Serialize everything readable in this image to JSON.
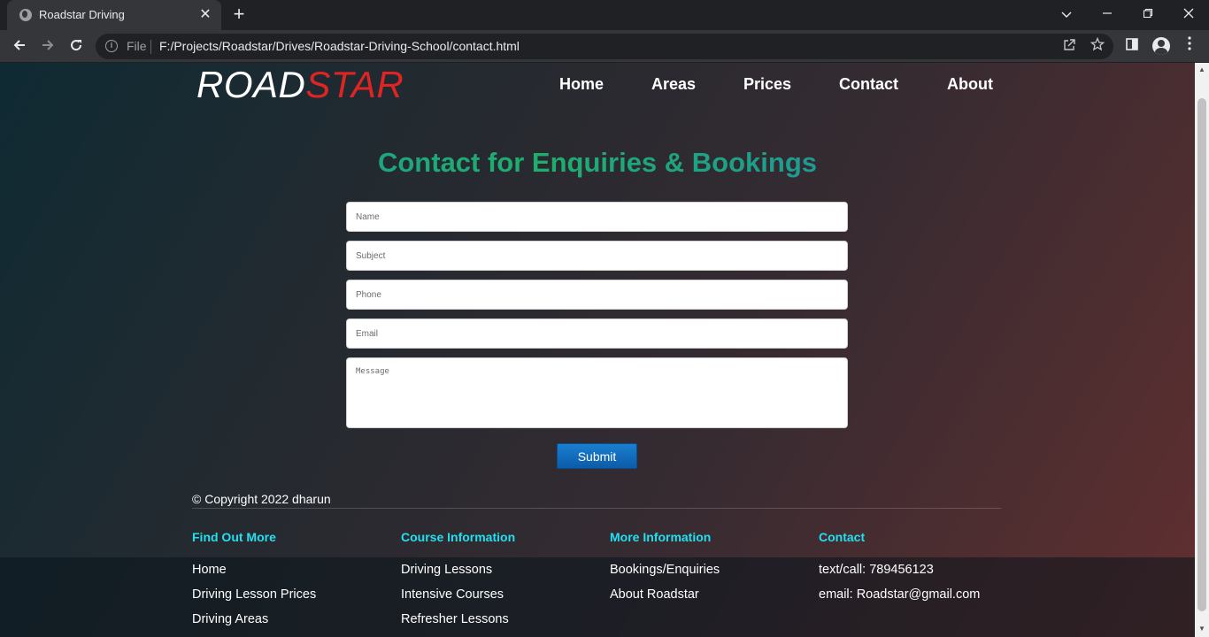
{
  "browser": {
    "tab_title": "Roadstar Driving",
    "tab_close": "✕",
    "new_tab": "+",
    "scheme_label": "File",
    "url": "F:/Projects/Roadstar/Drives/Roadstar-Driving-School/contact.html",
    "icons": [
      "globe-icon",
      "close-icon",
      "plus-icon",
      "chevron-down-icon",
      "minimize-icon",
      "restore-icon",
      "close-window-icon",
      "back-arrow-icon",
      "forward-arrow-icon",
      "reload-icon",
      "info-icon",
      "share-icon",
      "star-icon",
      "side-panel-icon",
      "profile-icon",
      "kebab-menu-icon"
    ]
  },
  "site": {
    "logo_part1": "ROAD",
    "logo_part2": "STAR",
    "logo_accent_color": "#e02424",
    "nav": [
      "Home",
      "Areas",
      "Prices",
      "Contact",
      "About"
    ]
  },
  "contact": {
    "heading": "Contact for Enquiries & Bookings",
    "fields": {
      "name": "Name",
      "subject": "Subject",
      "phone": "Phone",
      "email": "Email",
      "message": "Message"
    },
    "submit_label": "Submit",
    "submit_color": "#0c6ebd"
  },
  "footer": {
    "copyright": "© Copyright 2022 dharun",
    "heading_color": "#22e0f0",
    "columns": [
      {
        "title": "Find Out More",
        "links": [
          "Home",
          "Driving Lesson Prices",
          "Driving Areas"
        ]
      },
      {
        "title": "Course Information",
        "links": [
          "Driving Lessons",
          "Intensive Courses",
          "Refresher Lessons"
        ]
      },
      {
        "title": "More Information",
        "links": [
          "Bookings/Enquiries",
          "About Roadstar"
        ]
      },
      {
        "title": "Contact",
        "links": [
          "text/call: 789456123",
          "email: Roadstar@gmail.com"
        ]
      }
    ]
  }
}
